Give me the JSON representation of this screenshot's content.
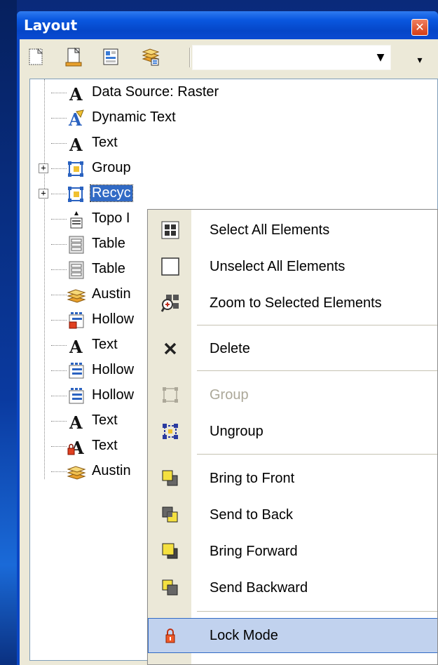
{
  "window": {
    "title": "Layout"
  },
  "toolbar": {
    "combo_value": ""
  },
  "tree": {
    "items": [
      {
        "label": "Data Source: Raster",
        "icon": "text-a-icon",
        "expandable": false,
        "selected": false
      },
      {
        "label": "Dynamic Text",
        "icon": "dynamic-text-icon",
        "expandable": false,
        "selected": false
      },
      {
        "label": "Text",
        "icon": "text-a-icon",
        "expandable": false,
        "selected": false
      },
      {
        "label": "Group",
        "icon": "group-icon",
        "expandable": true,
        "selected": false
      },
      {
        "label": "Recyc",
        "icon": "group-icon",
        "expandable": true,
        "selected": true
      },
      {
        "label": "Topo I",
        "icon": "north-arrow-icon",
        "expandable": false,
        "selected": false
      },
      {
        "label": "Table",
        "icon": "table-icon",
        "expandable": false,
        "selected": false
      },
      {
        "label": "Table",
        "icon": "table-icon",
        "expandable": false,
        "selected": false
      },
      {
        "label": "Austin",
        "icon": "map-frame-icon",
        "expandable": false,
        "selected": false
      },
      {
        "label": "Hollow",
        "icon": "locked-legend-icon",
        "expandable": false,
        "selected": false
      },
      {
        "label": "Text",
        "icon": "text-a-icon",
        "expandable": false,
        "selected": false
      },
      {
        "label": "Hollow",
        "icon": "legend-icon",
        "expandable": false,
        "selected": false
      },
      {
        "label": "Hollow",
        "icon": "legend-icon",
        "expandable": false,
        "selected": false
      },
      {
        "label": "Text",
        "icon": "text-a-icon",
        "expandable": false,
        "selected": false
      },
      {
        "label": "Text",
        "icon": "locked-text-icon",
        "expandable": false,
        "selected": false
      },
      {
        "label": "Austin",
        "icon": "map-frame-icon",
        "expandable": false,
        "selected": false
      }
    ]
  },
  "context_menu": {
    "items": [
      {
        "label": "Select All Elements",
        "icon": "select-all-icon"
      },
      {
        "label": "Unselect All Elements",
        "icon": "unselect-all-icon"
      },
      {
        "label": "Zoom to Selected Elements",
        "icon": "zoom-selected-icon"
      },
      {
        "label": "Delete",
        "icon": "delete-icon"
      },
      {
        "label": "Group",
        "icon": "group-icon",
        "disabled": true
      },
      {
        "label": "Ungroup",
        "icon": "ungroup-icon"
      },
      {
        "label": "Bring to Front",
        "icon": "bring-to-front-icon"
      },
      {
        "label": "Send to Back",
        "icon": "send-to-back-icon"
      },
      {
        "label": "Bring Forward",
        "icon": "bring-forward-icon"
      },
      {
        "label": "Send Backward",
        "icon": "send-backward-icon"
      },
      {
        "label": "Lock Mode",
        "icon": "lock-icon",
        "highlighted": true
      }
    ]
  },
  "colors": {
    "selection": "#316ac5",
    "menu_highlight": "#c1d2ee",
    "titlebar": "#0a58e0"
  }
}
